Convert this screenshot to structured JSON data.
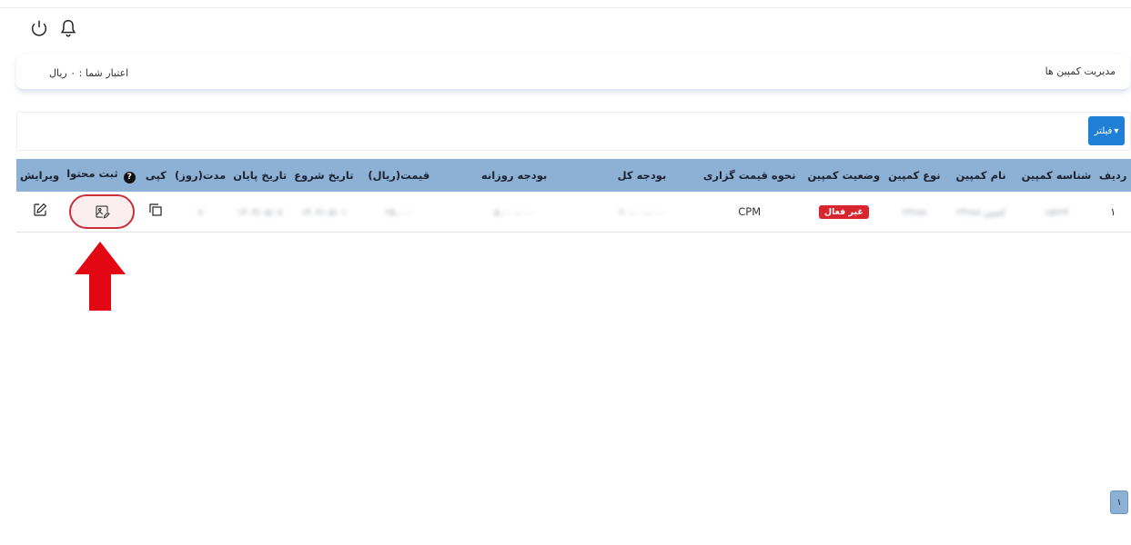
{
  "topbar": {
    "power_icon": "power-icon",
    "bell_icon": "bell-icon"
  },
  "header": {
    "page_title": "مدیریت کمپین ها",
    "credit_text": "اعتبار شما : ۰ ریال"
  },
  "filter": {
    "label": "فیلتر",
    "caret": "▾"
  },
  "table": {
    "headers": {
      "row": "ردیف",
      "id": "شناسه کمپین",
      "name": "نام کمپین",
      "type": "نوع کمپین",
      "status": "وضعیت کمپین",
      "pricing": "نحوه قیمت گزاری",
      "total_budget": "بودجه کل",
      "daily_budget": "بودجه روزانه",
      "price": "قیمت(ریال)",
      "start_date": "تاریخ شروع",
      "end_date": "تاریخ پایان",
      "duration": "مدت(روز)",
      "copy": "کپی",
      "content": "ثبت محتوا",
      "edit": "ویرایش"
    },
    "help_mark": "?",
    "row1": {
      "row": "۱",
      "id": "۱۵۶۲۳",
      "name": "کمپین ۲۳۶۸۸",
      "type": "۲۳۶۸۸",
      "status": "غیر فعال",
      "pricing": "CPM",
      "total_budget": "۲۰،۰۰۰،۰۰۰",
      "daily_budget": "۵،۰۰۰،۰۰۰",
      "price": "۲۵،۰۰۰",
      "start_date": "۱۴۰۳/۰۵/۰۱",
      "end_date": "۱۴۰۳/۰۵/۰۷",
      "duration": "۷"
    }
  },
  "pagination": {
    "current": "۱"
  },
  "colors": {
    "header_bg": "#8db0d5",
    "filter_btn": "#1f7fd6",
    "badge": "#d7262d",
    "highlight": "#c9303a",
    "arrow": "#e30613"
  }
}
